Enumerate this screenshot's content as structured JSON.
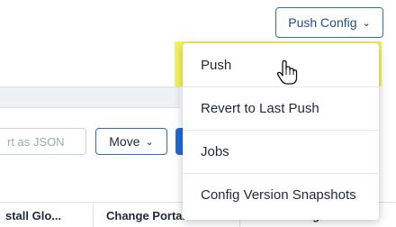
{
  "push_config_button": {
    "label": "Push Config"
  },
  "toolbar": {
    "export_label": "rt as JSON",
    "move_label": "Move"
  },
  "menu": {
    "items": [
      {
        "label": "Push"
      },
      {
        "label": "Revert to Last Push"
      },
      {
        "label": "Jobs"
      },
      {
        "label": "Config Version Snapshots"
      }
    ]
  },
  "table": {
    "columns": [
      "stall Glo...",
      "Change Portal",
      "Enable Log C..."
    ]
  },
  "colors": {
    "accent": "#1e6bd6",
    "highlight": "#f0f046"
  },
  "icons": [
    "chevron-down-icon",
    "hand-pointer-icon"
  ]
}
